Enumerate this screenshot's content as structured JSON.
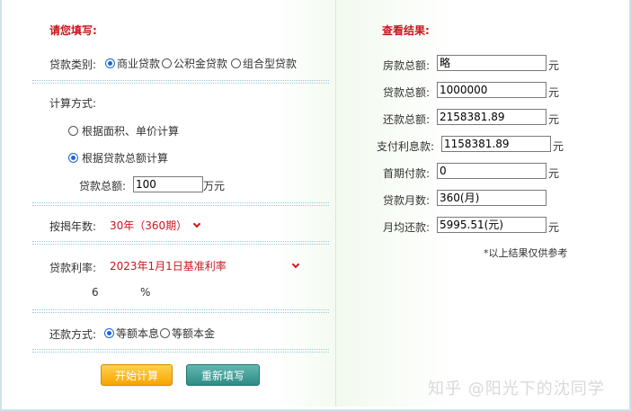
{
  "form": {
    "title": "请您填写:",
    "loan_type": {
      "label": "贷款类别:",
      "options": [
        "商业贷款",
        "公积金贷款",
        "组合型贷款"
      ],
      "selected": "商业贷款"
    },
    "calc_method": {
      "label": "计算方式:",
      "options": [
        "根据面积、单价计算",
        "根据贷款总额计算"
      ],
      "selected": "根据贷款总额计算"
    },
    "loan_total": {
      "label": "贷款总额:",
      "value": "100",
      "unit": "万元"
    },
    "years": {
      "label": "按揭年数:",
      "value": "30年（360期）"
    },
    "rate": {
      "label": "贷款利率:",
      "value": "2023年1月1日基准利率",
      "rate_value": "6",
      "unit": "%"
    },
    "repay": {
      "label": "还款方式:",
      "options": [
        "等额本息",
        "等额本金"
      ],
      "selected": "等额本息"
    },
    "start_button": "开始计算",
    "reset_button": "重新填写"
  },
  "result": {
    "title": "查看结果:",
    "rows": [
      {
        "label": "房款总额:",
        "value": "略",
        "unit": "元"
      },
      {
        "label": "贷款总额:",
        "value": "1000000",
        "unit": "元"
      },
      {
        "label": "还款总额:",
        "value": "2158381.89",
        "unit": "元"
      },
      {
        "label": "支付利息款:",
        "value": "1158381.89",
        "unit": "元"
      },
      {
        "label": "首期付款:",
        "value": "0",
        "unit": "元"
      },
      {
        "label": "贷款月数:",
        "value": "360(月)",
        "unit": ""
      },
      {
        "label": "月均还款:",
        "value": "5995.51(元)",
        "unit": "元"
      }
    ],
    "note": "*以上结果仅供参考"
  },
  "watermark": "知乎 @阳光下的沈同学"
}
